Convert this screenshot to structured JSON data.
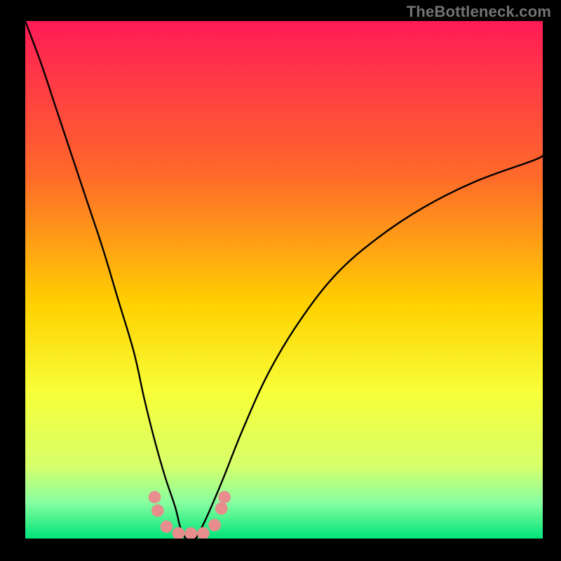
{
  "watermark": "TheBottleneck.com",
  "chart_data": {
    "type": "line",
    "title": "",
    "xlabel": "",
    "ylabel": "",
    "xlim": [
      0,
      100
    ],
    "ylim": [
      0,
      100
    ],
    "grid": false,
    "gradient_stops": [
      {
        "offset": 0.0,
        "color": "#ff1b56"
      },
      {
        "offset": 0.3,
        "color": "#ff6a2a"
      },
      {
        "offset": 0.55,
        "color": "#ffd200"
      },
      {
        "offset": 0.72,
        "color": "#f7ff3a"
      },
      {
        "offset": 0.86,
        "color": "#d6ff6a"
      },
      {
        "offset": 0.93,
        "color": "#88ffa0"
      },
      {
        "offset": 1.0,
        "color": "#00e47a"
      }
    ],
    "series": [
      {
        "name": "left-branch",
        "x": [
          0,
          3,
          6,
          9,
          12,
          15,
          18,
          21,
          23,
          25,
          27,
          29,
          30,
          31
        ],
        "values": [
          100,
          92,
          83,
          74,
          65,
          56,
          46,
          36,
          27,
          19,
          12,
          6,
          2,
          0
        ]
      },
      {
        "name": "right-branch",
        "x": [
          33,
          35,
          38,
          42,
          47,
          53,
          60,
          68,
          77,
          87,
          98,
          100
        ],
        "values": [
          0,
          4,
          11,
          21,
          32,
          42,
          51,
          58,
          64,
          69,
          73,
          74
        ]
      },
      {
        "name": "bottom-connector",
        "x": [
          31,
          33
        ],
        "values": [
          0,
          0
        ]
      }
    ],
    "dots": {
      "name": "bottom-dots",
      "color": "#e88d8d",
      "radius_pct": 1.2,
      "points": [
        {
          "x": 25.0,
          "y": 8.0
        },
        {
          "x": 25.6,
          "y": 5.4
        },
        {
          "x": 27.3,
          "y": 2.3
        },
        {
          "x": 29.6,
          "y": 1.0
        },
        {
          "x": 32.0,
          "y": 1.0
        },
        {
          "x": 34.4,
          "y": 1.0
        },
        {
          "x": 36.6,
          "y": 2.6
        },
        {
          "x": 37.9,
          "y": 5.8
        },
        {
          "x": 38.5,
          "y": 8.0
        }
      ]
    }
  }
}
